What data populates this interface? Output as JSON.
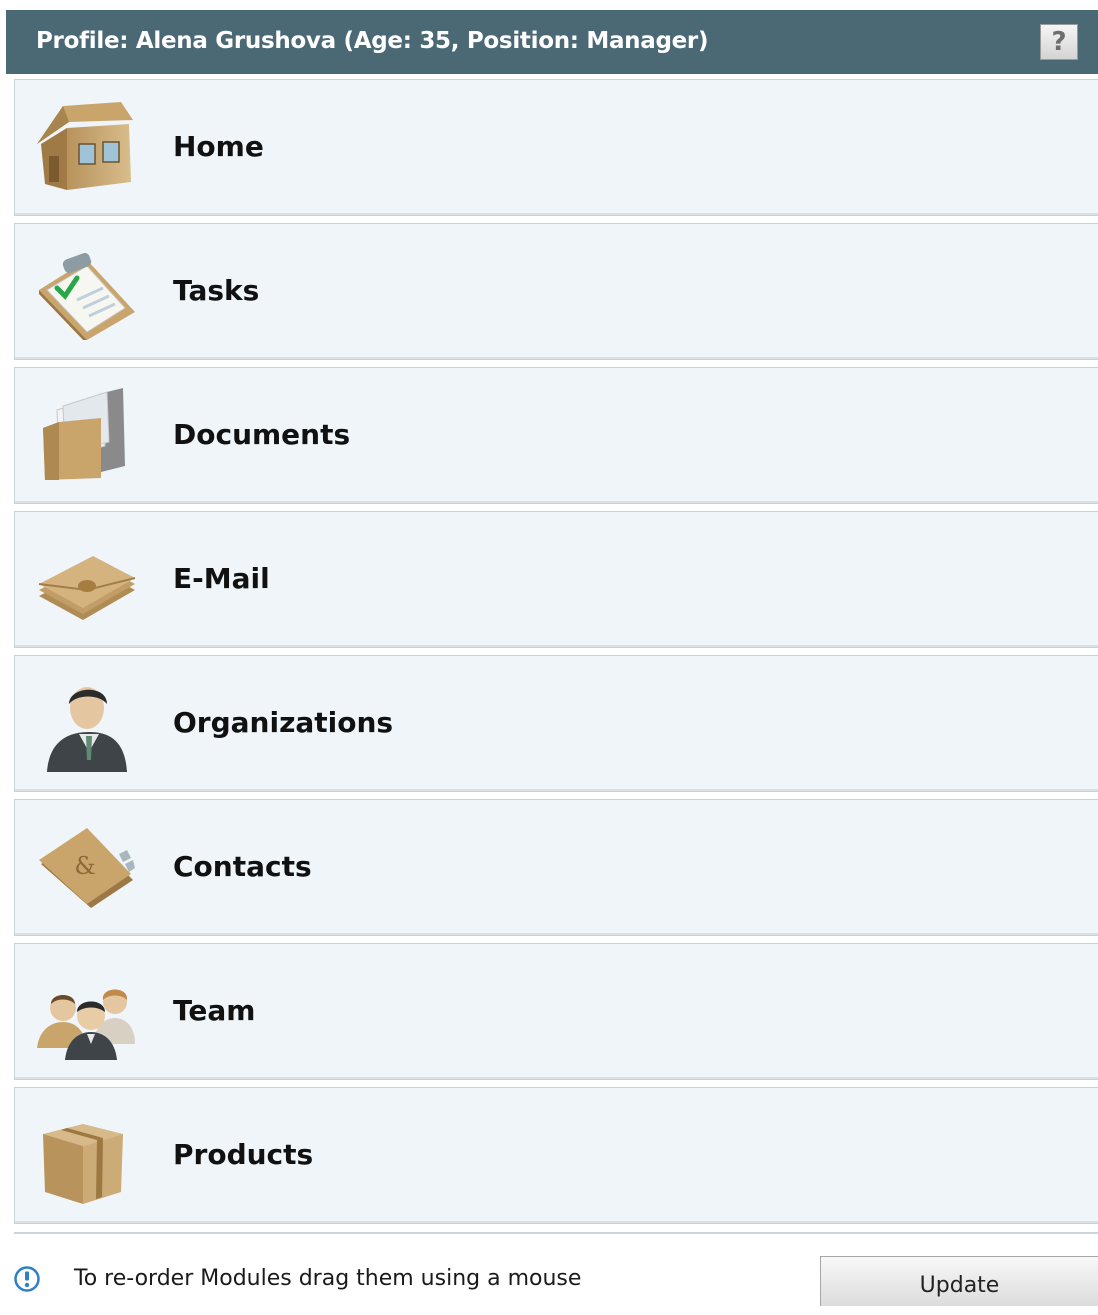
{
  "header": {
    "title": "Profile: Alena Grushova (Age: 35, Position: Manager)",
    "help_label": "?",
    "background": "#4b6875"
  },
  "modules": [
    {
      "label": "Home",
      "icon": "house-icon"
    },
    {
      "label": "Tasks",
      "icon": "clipboard-checklist-icon"
    },
    {
      "label": "Documents",
      "icon": "folder-documents-icon"
    },
    {
      "label": "E-Mail",
      "icon": "envelope-stack-icon"
    },
    {
      "label": "Organizations",
      "icon": "businessman-icon"
    },
    {
      "label": "Contacts",
      "icon": "address-book-icon"
    },
    {
      "label": "Team",
      "icon": "group-people-icon"
    },
    {
      "label": "Products",
      "icon": "cardboard-box-icon"
    }
  ],
  "footer": {
    "hint": "To re-order Modules drag them using a mouse",
    "update_label": "Update",
    "info_icon": "info-icon"
  }
}
